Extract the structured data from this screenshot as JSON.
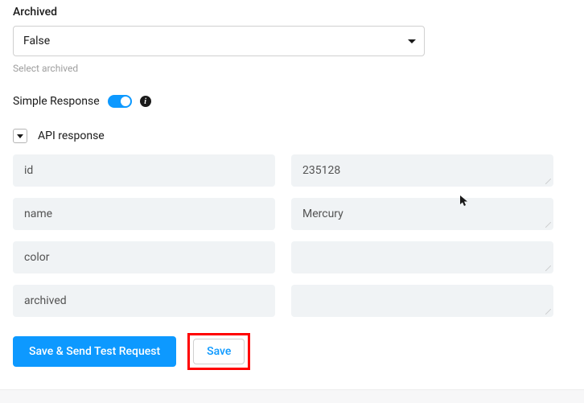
{
  "archived_section": {
    "label": "Archived",
    "value": "False",
    "helper": "Select archived"
  },
  "simple_response": {
    "label": "Simple Response",
    "enabled": true
  },
  "api_response": {
    "title": "API response",
    "rows": [
      {
        "key": "id",
        "value": "235128"
      },
      {
        "key": "name",
        "value": "Mercury"
      },
      {
        "key": "color",
        "value": ""
      },
      {
        "key": "archived",
        "value": ""
      }
    ]
  },
  "buttons": {
    "primary": "Save & Send Test Request",
    "secondary": "Save"
  }
}
